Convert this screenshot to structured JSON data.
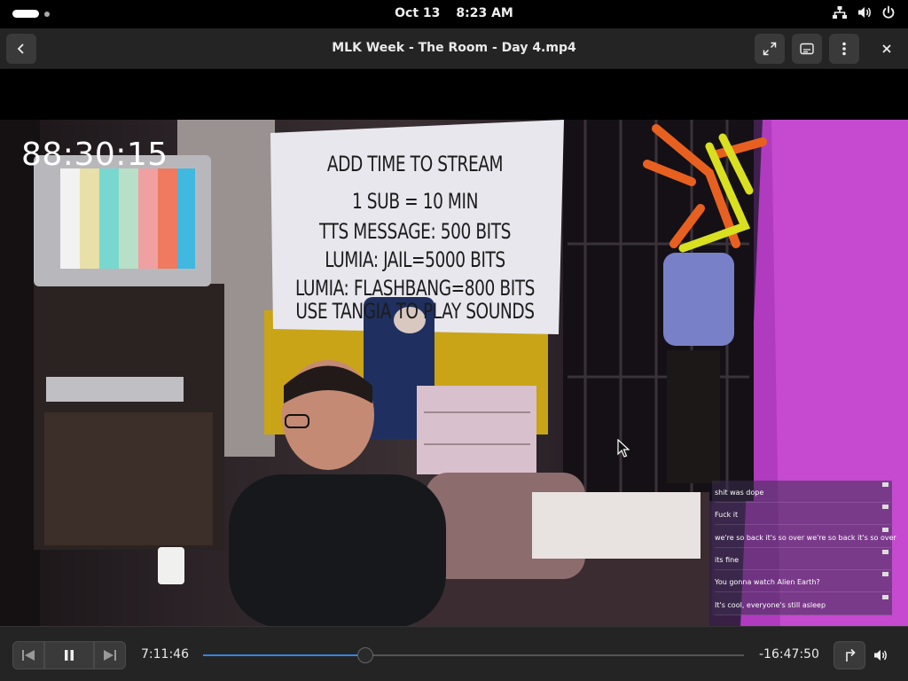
{
  "system_bar": {
    "date": "Oct 13",
    "time": "8:23 AM"
  },
  "header": {
    "title": "MLK Week - The Room - Day 4.mp4",
    "back_icon": "chevron-left-icon",
    "fullscreen_icon": "fullscreen-icon",
    "subtitles_icon": "subtitles-icon",
    "menu_icon": "kebab-menu-icon",
    "close_icon": "close-icon"
  },
  "video": {
    "stream_timer": "88:30:15",
    "whiteboard": [
      "ADD TIME TO STREAM",
      "1 SUB = 10 MIN",
      "TTS MESSAGE: 500 BITS",
      "LUMIA: JAIL=5000 BITS",
      "LUMIA: FLASHBANG=800 BITS",
      "USE TANGIA TO PLAY SOUNDS"
    ],
    "chat": [
      {
        "message": "shit was dope"
      },
      {
        "message": "Fuck it"
      },
      {
        "message": "we're so back it's so over we're so back it's so over"
      },
      {
        "message": "its fine"
      },
      {
        "message": "You gonna watch Alien Earth?"
      },
      {
        "message": "It's cool, everyone's still asleep"
      }
    ]
  },
  "controls": {
    "elapsed": "7:11:46",
    "remaining": "-16:47:50",
    "progress_fraction": 0.3,
    "accent_color": "#3584e4"
  }
}
